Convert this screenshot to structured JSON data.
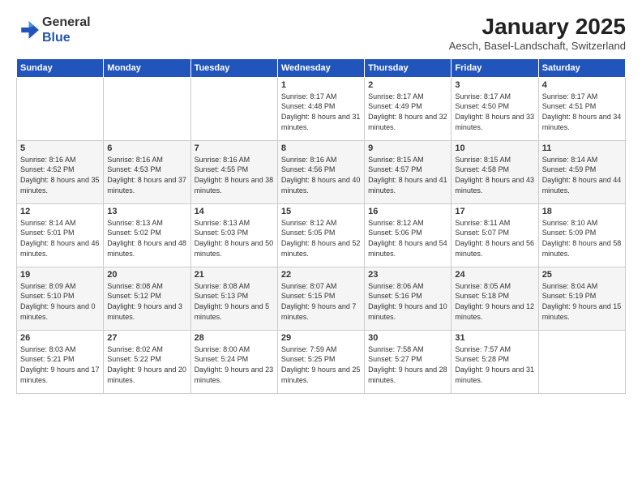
{
  "logo": {
    "general": "General",
    "blue": "Blue"
  },
  "title": "January 2025",
  "subtitle": "Aesch, Basel-Landschaft, Switzerland",
  "weekdays": [
    "Sunday",
    "Monday",
    "Tuesday",
    "Wednesday",
    "Thursday",
    "Friday",
    "Saturday"
  ],
  "weeks": [
    [
      {
        "day": "",
        "info": ""
      },
      {
        "day": "",
        "info": ""
      },
      {
        "day": "",
        "info": ""
      },
      {
        "day": "1",
        "info": "Sunrise: 8:17 AM\nSunset: 4:48 PM\nDaylight: 8 hours\nand 31 minutes."
      },
      {
        "day": "2",
        "info": "Sunrise: 8:17 AM\nSunset: 4:49 PM\nDaylight: 8 hours\nand 32 minutes."
      },
      {
        "day": "3",
        "info": "Sunrise: 8:17 AM\nSunset: 4:50 PM\nDaylight: 8 hours\nand 33 minutes."
      },
      {
        "day": "4",
        "info": "Sunrise: 8:17 AM\nSunset: 4:51 PM\nDaylight: 8 hours\nand 34 minutes."
      }
    ],
    [
      {
        "day": "5",
        "info": "Sunrise: 8:16 AM\nSunset: 4:52 PM\nDaylight: 8 hours\nand 35 minutes."
      },
      {
        "day": "6",
        "info": "Sunrise: 8:16 AM\nSunset: 4:53 PM\nDaylight: 8 hours\nand 37 minutes."
      },
      {
        "day": "7",
        "info": "Sunrise: 8:16 AM\nSunset: 4:55 PM\nDaylight: 8 hours\nand 38 minutes."
      },
      {
        "day": "8",
        "info": "Sunrise: 8:16 AM\nSunset: 4:56 PM\nDaylight: 8 hours\nand 40 minutes."
      },
      {
        "day": "9",
        "info": "Sunrise: 8:15 AM\nSunset: 4:57 PM\nDaylight: 8 hours\nand 41 minutes."
      },
      {
        "day": "10",
        "info": "Sunrise: 8:15 AM\nSunset: 4:58 PM\nDaylight: 8 hours\nand 43 minutes."
      },
      {
        "day": "11",
        "info": "Sunrise: 8:14 AM\nSunset: 4:59 PM\nDaylight: 8 hours\nand 44 minutes."
      }
    ],
    [
      {
        "day": "12",
        "info": "Sunrise: 8:14 AM\nSunset: 5:01 PM\nDaylight: 8 hours\nand 46 minutes."
      },
      {
        "day": "13",
        "info": "Sunrise: 8:13 AM\nSunset: 5:02 PM\nDaylight: 8 hours\nand 48 minutes."
      },
      {
        "day": "14",
        "info": "Sunrise: 8:13 AM\nSunset: 5:03 PM\nDaylight: 8 hours\nand 50 minutes."
      },
      {
        "day": "15",
        "info": "Sunrise: 8:12 AM\nSunset: 5:05 PM\nDaylight: 8 hours\nand 52 minutes."
      },
      {
        "day": "16",
        "info": "Sunrise: 8:12 AM\nSunset: 5:06 PM\nDaylight: 8 hours\nand 54 minutes."
      },
      {
        "day": "17",
        "info": "Sunrise: 8:11 AM\nSunset: 5:07 PM\nDaylight: 8 hours\nand 56 minutes."
      },
      {
        "day": "18",
        "info": "Sunrise: 8:10 AM\nSunset: 5:09 PM\nDaylight: 8 hours\nand 58 minutes."
      }
    ],
    [
      {
        "day": "19",
        "info": "Sunrise: 8:09 AM\nSunset: 5:10 PM\nDaylight: 9 hours\nand 0 minutes."
      },
      {
        "day": "20",
        "info": "Sunrise: 8:08 AM\nSunset: 5:12 PM\nDaylight: 9 hours\nand 3 minutes."
      },
      {
        "day": "21",
        "info": "Sunrise: 8:08 AM\nSunset: 5:13 PM\nDaylight: 9 hours\nand 5 minutes."
      },
      {
        "day": "22",
        "info": "Sunrise: 8:07 AM\nSunset: 5:15 PM\nDaylight: 9 hours\nand 7 minutes."
      },
      {
        "day": "23",
        "info": "Sunrise: 8:06 AM\nSunset: 5:16 PM\nDaylight: 9 hours\nand 10 minutes."
      },
      {
        "day": "24",
        "info": "Sunrise: 8:05 AM\nSunset: 5:18 PM\nDaylight: 9 hours\nand 12 minutes."
      },
      {
        "day": "25",
        "info": "Sunrise: 8:04 AM\nSunset: 5:19 PM\nDaylight: 9 hours\nand 15 minutes."
      }
    ],
    [
      {
        "day": "26",
        "info": "Sunrise: 8:03 AM\nSunset: 5:21 PM\nDaylight: 9 hours\nand 17 minutes."
      },
      {
        "day": "27",
        "info": "Sunrise: 8:02 AM\nSunset: 5:22 PM\nDaylight: 9 hours\nand 20 minutes."
      },
      {
        "day": "28",
        "info": "Sunrise: 8:00 AM\nSunset: 5:24 PM\nDaylight: 9 hours\nand 23 minutes."
      },
      {
        "day": "29",
        "info": "Sunrise: 7:59 AM\nSunset: 5:25 PM\nDaylight: 9 hours\nand 25 minutes."
      },
      {
        "day": "30",
        "info": "Sunrise: 7:58 AM\nSunset: 5:27 PM\nDaylight: 9 hours\nand 28 minutes."
      },
      {
        "day": "31",
        "info": "Sunrise: 7:57 AM\nSunset: 5:28 PM\nDaylight: 9 hours\nand 31 minutes."
      },
      {
        "day": "",
        "info": ""
      }
    ]
  ]
}
